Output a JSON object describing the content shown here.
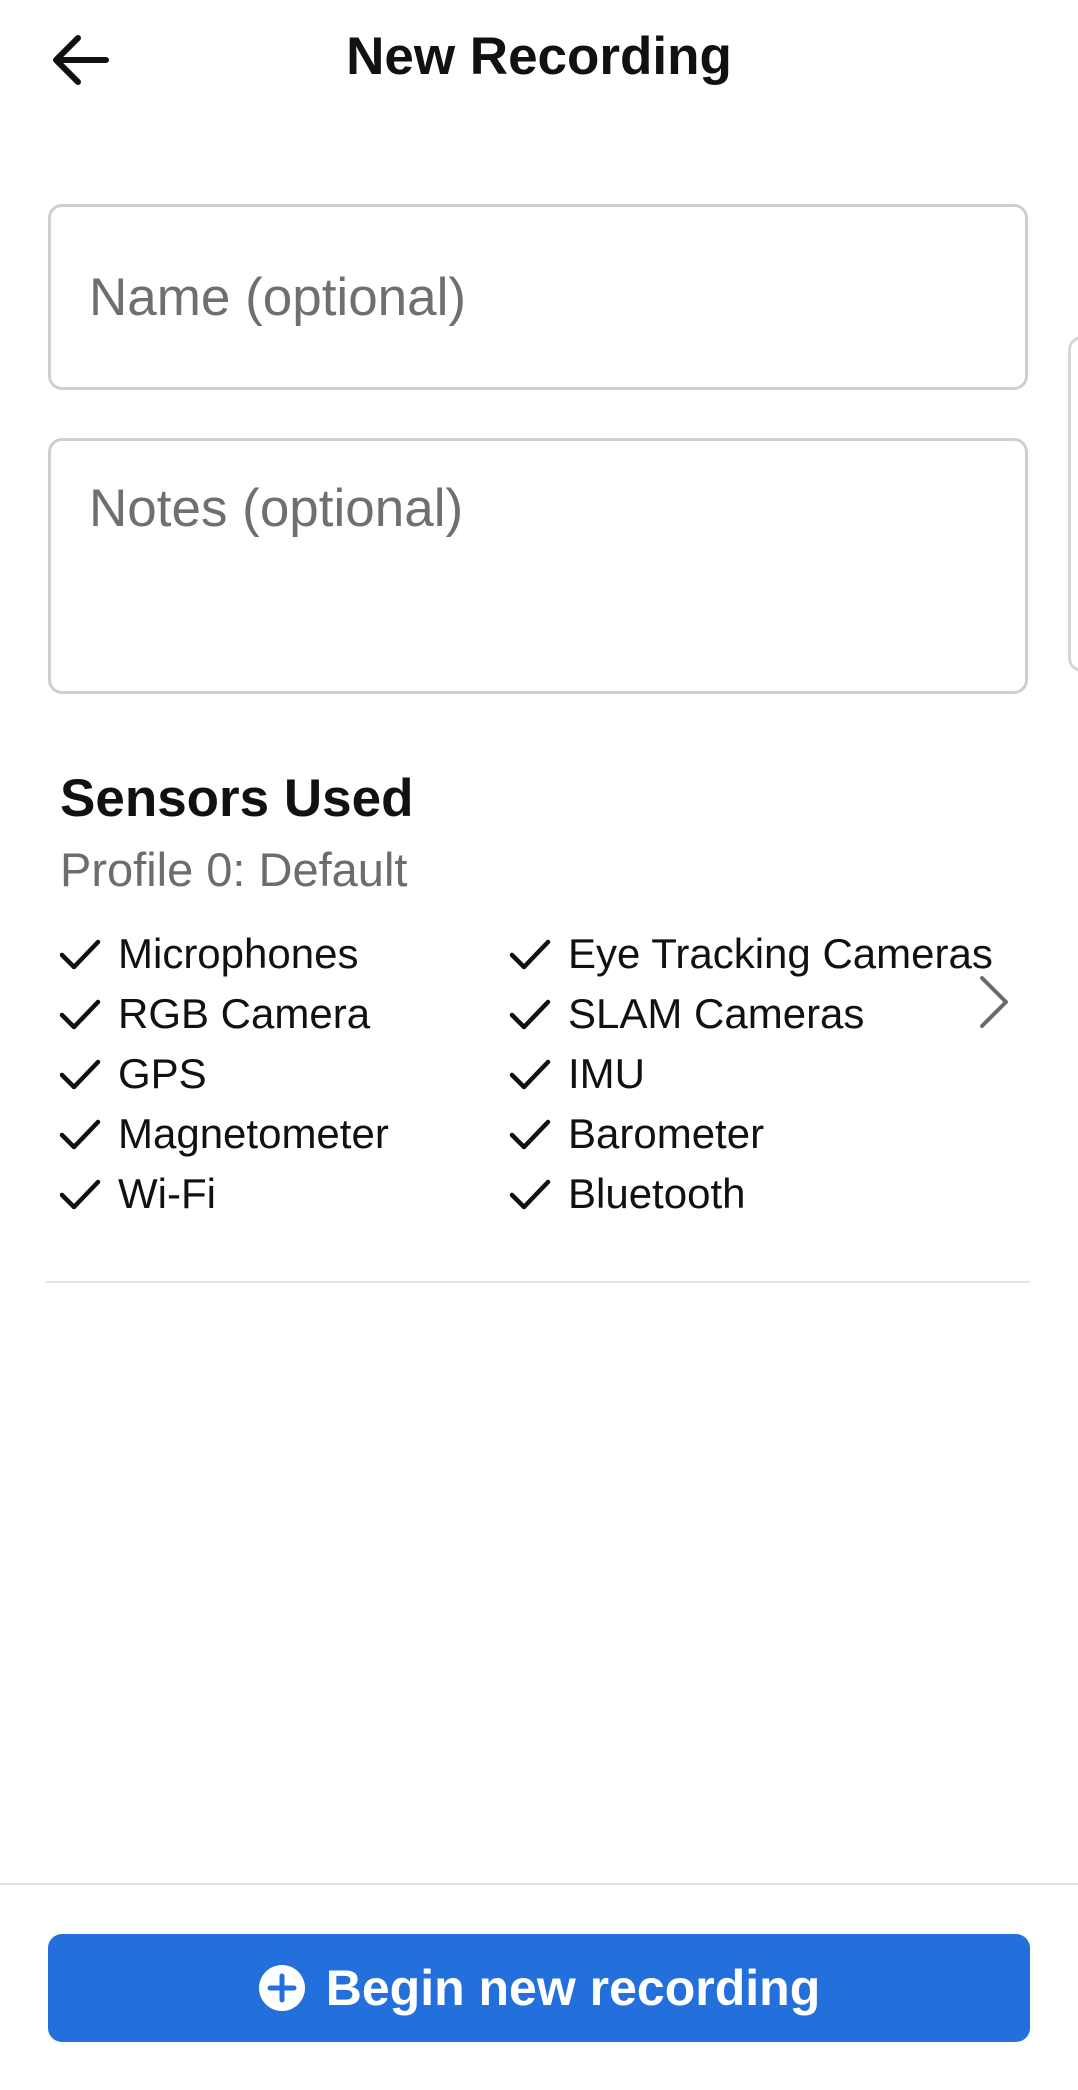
{
  "header": {
    "title": "New Recording",
    "back_icon": "arrow-left-icon"
  },
  "form": {
    "name_placeholder": "Name (optional)",
    "name_value": "",
    "notes_placeholder": "Notes (optional)",
    "notes_value": ""
  },
  "sensors": {
    "title": "Sensors Used",
    "profile": "Profile 0: Default",
    "check_icon": "checkmark-icon",
    "chevron_icon": "chevron-right-icon",
    "left_column": [
      "Microphones",
      "RGB Camera",
      "GPS",
      "Magnetometer",
      "Wi-Fi"
    ],
    "right_column": [
      "Eye Tracking Cameras",
      "SLAM Cameras",
      "IMU",
      "Barometer",
      "Bluetooth"
    ]
  },
  "footer": {
    "begin_label": "Begin new recording",
    "begin_icon": "plus-circle-icon",
    "button_color": "#2370dd"
  }
}
